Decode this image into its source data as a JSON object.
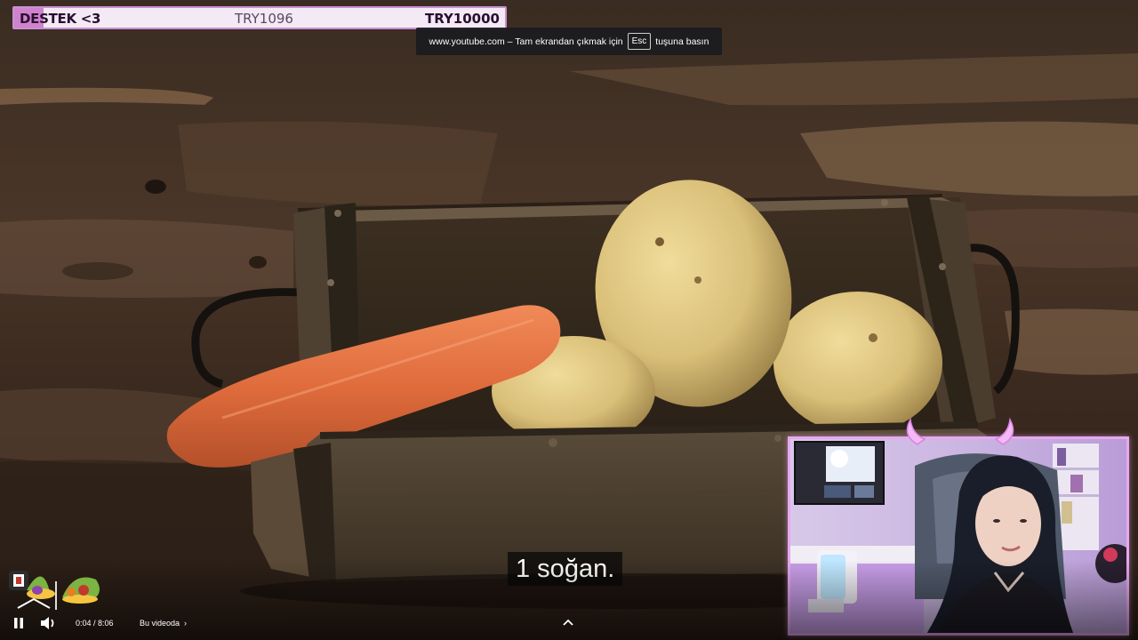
{
  "goal": {
    "title": "DESTEK <3",
    "current": "TRY1096",
    "target": "TRY10000",
    "progress_fraction": 0.1096,
    "fill_color": "#cf83cf",
    "background_color": "#f3eaf6"
  },
  "fullscreen_notice": {
    "text_before": "www.youtube.com – Tam ekrandan çıkmak için",
    "key": "Esc",
    "text_after": "tuşuna basın"
  },
  "subtitle": {
    "text": "1 soğan."
  },
  "player": {
    "time": "0:04 / 8:06",
    "in_video_label": "Bu videoda",
    "play_state": "playing",
    "icons": [
      "pause-icon",
      "volume-icon",
      "chevron-right-icon",
      "chevron-up-icon"
    ]
  },
  "webcam": {
    "border_color": "#e7a8f0"
  }
}
